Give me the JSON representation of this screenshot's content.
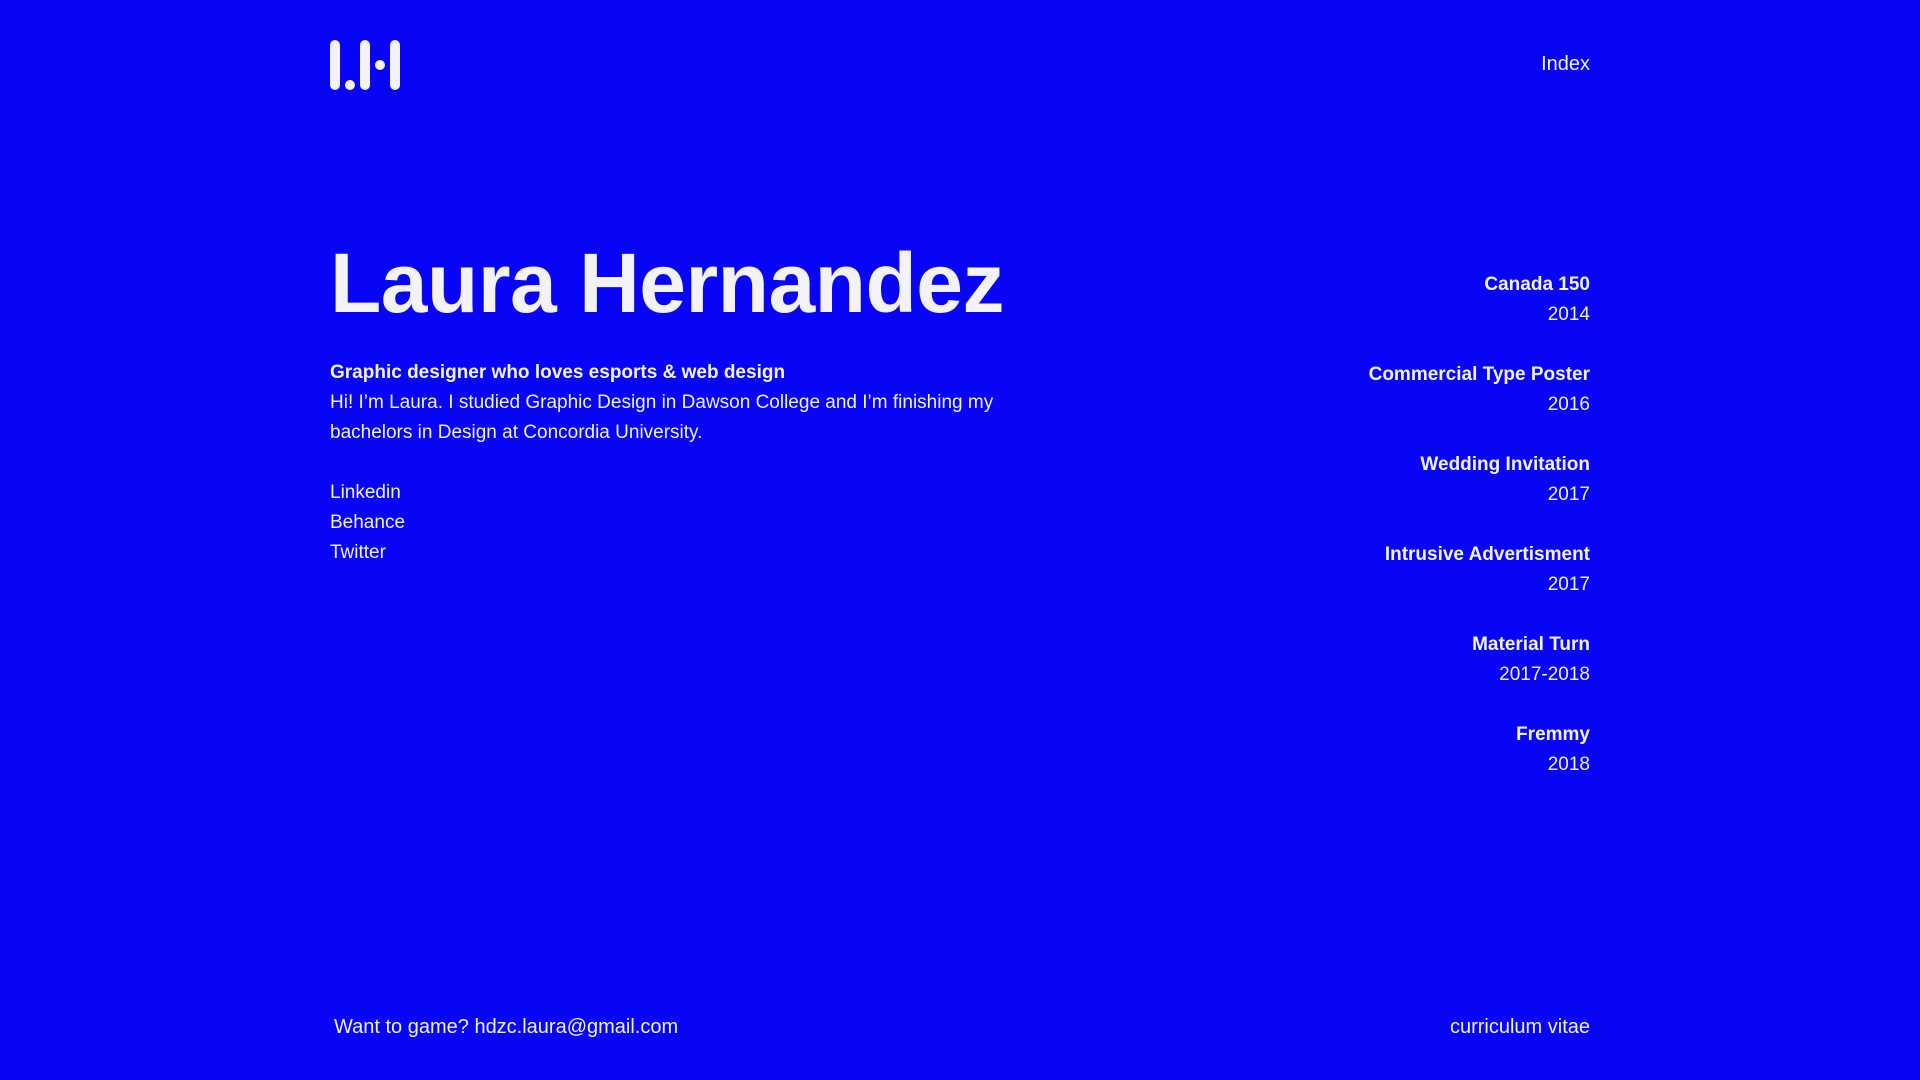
{
  "header": {
    "logo_alt": "LH",
    "nav_index": "Index"
  },
  "hero": {
    "name": "Laura Hernandez",
    "tagline": "Graphic designer who loves esports & web design",
    "bio": "Hi! I’m Laura. I studied Graphic Design in Dawson College and I’m finishing my bachelors in Design at Concordia University."
  },
  "social": [
    {
      "label": "Linkedin"
    },
    {
      "label": "Behance"
    },
    {
      "label": "Twitter"
    }
  ],
  "projects": [
    {
      "title": "Canada 150",
      "year": "2014"
    },
    {
      "title": "Commercial Type Poster",
      "year": "2016"
    },
    {
      "title": "Wedding Invitation",
      "year": "2017"
    },
    {
      "title": "Intrusive Advertisment",
      "year": "2017"
    },
    {
      "title": "Material Turn",
      "year": "2017-2018"
    },
    {
      "title": "Fremmy",
      "year": "2018"
    }
  ],
  "footer": {
    "contact": "Want to game? hdzc.laura@gmail.com",
    "cv_link": "curriculum vitae"
  },
  "colors": {
    "background": "#0805f7",
    "text": "#f2f2f7"
  }
}
